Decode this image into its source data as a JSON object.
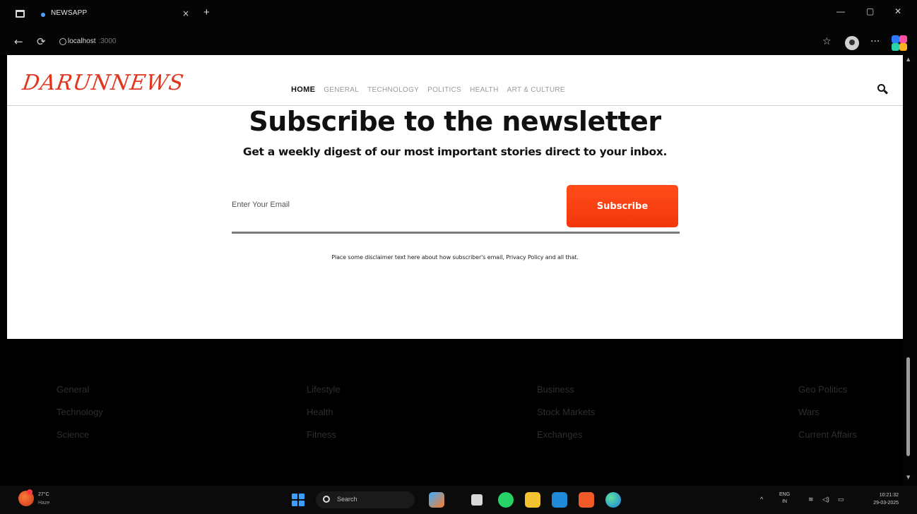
{
  "browser": {
    "tab_title": "NEWSAPP",
    "tab_close": "×",
    "new_tab": "+",
    "url": "localhost",
    "url_port": ":3000",
    "window_minimize": "—",
    "window_maximize": "▢",
    "window_close": "✕",
    "back_icon": "←",
    "reload_icon": "⟳",
    "favorite_icon": "☆",
    "more_icon": "···"
  },
  "site": {
    "logo": "DARUNNEWS",
    "nav": [
      {
        "label": "HOME",
        "active": true
      },
      {
        "label": "GENERAL"
      },
      {
        "label": "TECHNOLOGY"
      },
      {
        "label": "POLITICS"
      },
      {
        "label": "HEALTH"
      },
      {
        "label": "ART & CULTURE"
      }
    ]
  },
  "newsletter": {
    "title": "Subscribe to the newsletter",
    "subtitle": "Get a weekly digest of our most important stories direct to your inbox.",
    "email_placeholder": "Enter Your Email",
    "subscribe_label": "Subscribe",
    "disclaimer": "Place some disclaimer text here about how subscriber's email, Privacy Policy and all that."
  },
  "footer": {
    "columns": [
      [
        "General",
        "Technology",
        "Science"
      ],
      [
        "Lifestyle",
        "Health",
        "Fitness"
      ],
      [
        "Business",
        "Stock Markets",
        "Exchanges"
      ],
      [
        "Geo Politics",
        "Wars",
        "Current Affairs"
      ]
    ]
  },
  "taskbar": {
    "weather_temp": "27°C",
    "weather_desc": "Haze",
    "search_label": "Search",
    "lang_top": "ENG",
    "lang_bottom": "IN",
    "time": "10:21:32",
    "date": "29-03-2025",
    "tray_arrow": "^"
  }
}
